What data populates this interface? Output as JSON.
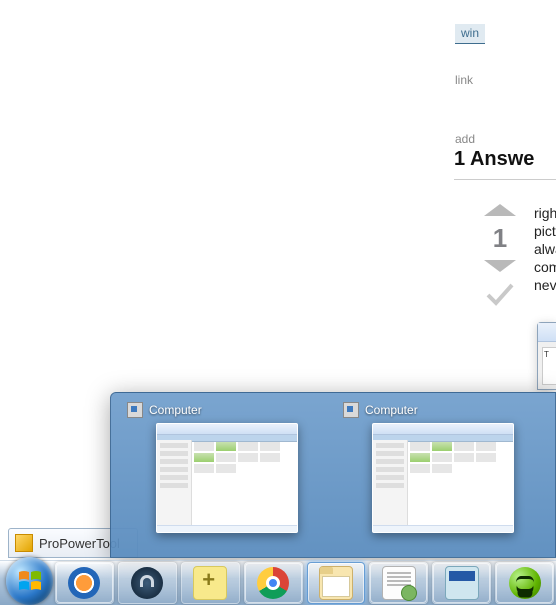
{
  "page": {
    "tag_text": "win",
    "meta_link": "link",
    "add_comment": "add",
    "answers_header": "1 Answe",
    "vote_score": "1",
    "answer_lines": [
      "righ",
      "pictu",
      "alwa",
      "com",
      "nev"
    ]
  },
  "browser_tab": {
    "label": "ProPowerTool"
  },
  "peek": {
    "items": [
      {
        "title": "Computer"
      },
      {
        "title": "Computer"
      }
    ]
  },
  "other_window_char": "T",
  "taskbar": {
    "items": [
      {
        "name": "start",
        "interactable": true
      },
      {
        "name": "windows-media-player",
        "interactable": true
      },
      {
        "name": "lock-app",
        "interactable": true
      },
      {
        "name": "sticky-notes",
        "interactable": true
      },
      {
        "name": "google-chrome",
        "interactable": true
      },
      {
        "name": "file-explorer",
        "interactable": true,
        "active": true
      },
      {
        "name": "notepad-plus-plus",
        "interactable": true
      },
      {
        "name": "console",
        "interactable": true
      },
      {
        "name": "spotify",
        "interactable": true
      }
    ]
  }
}
